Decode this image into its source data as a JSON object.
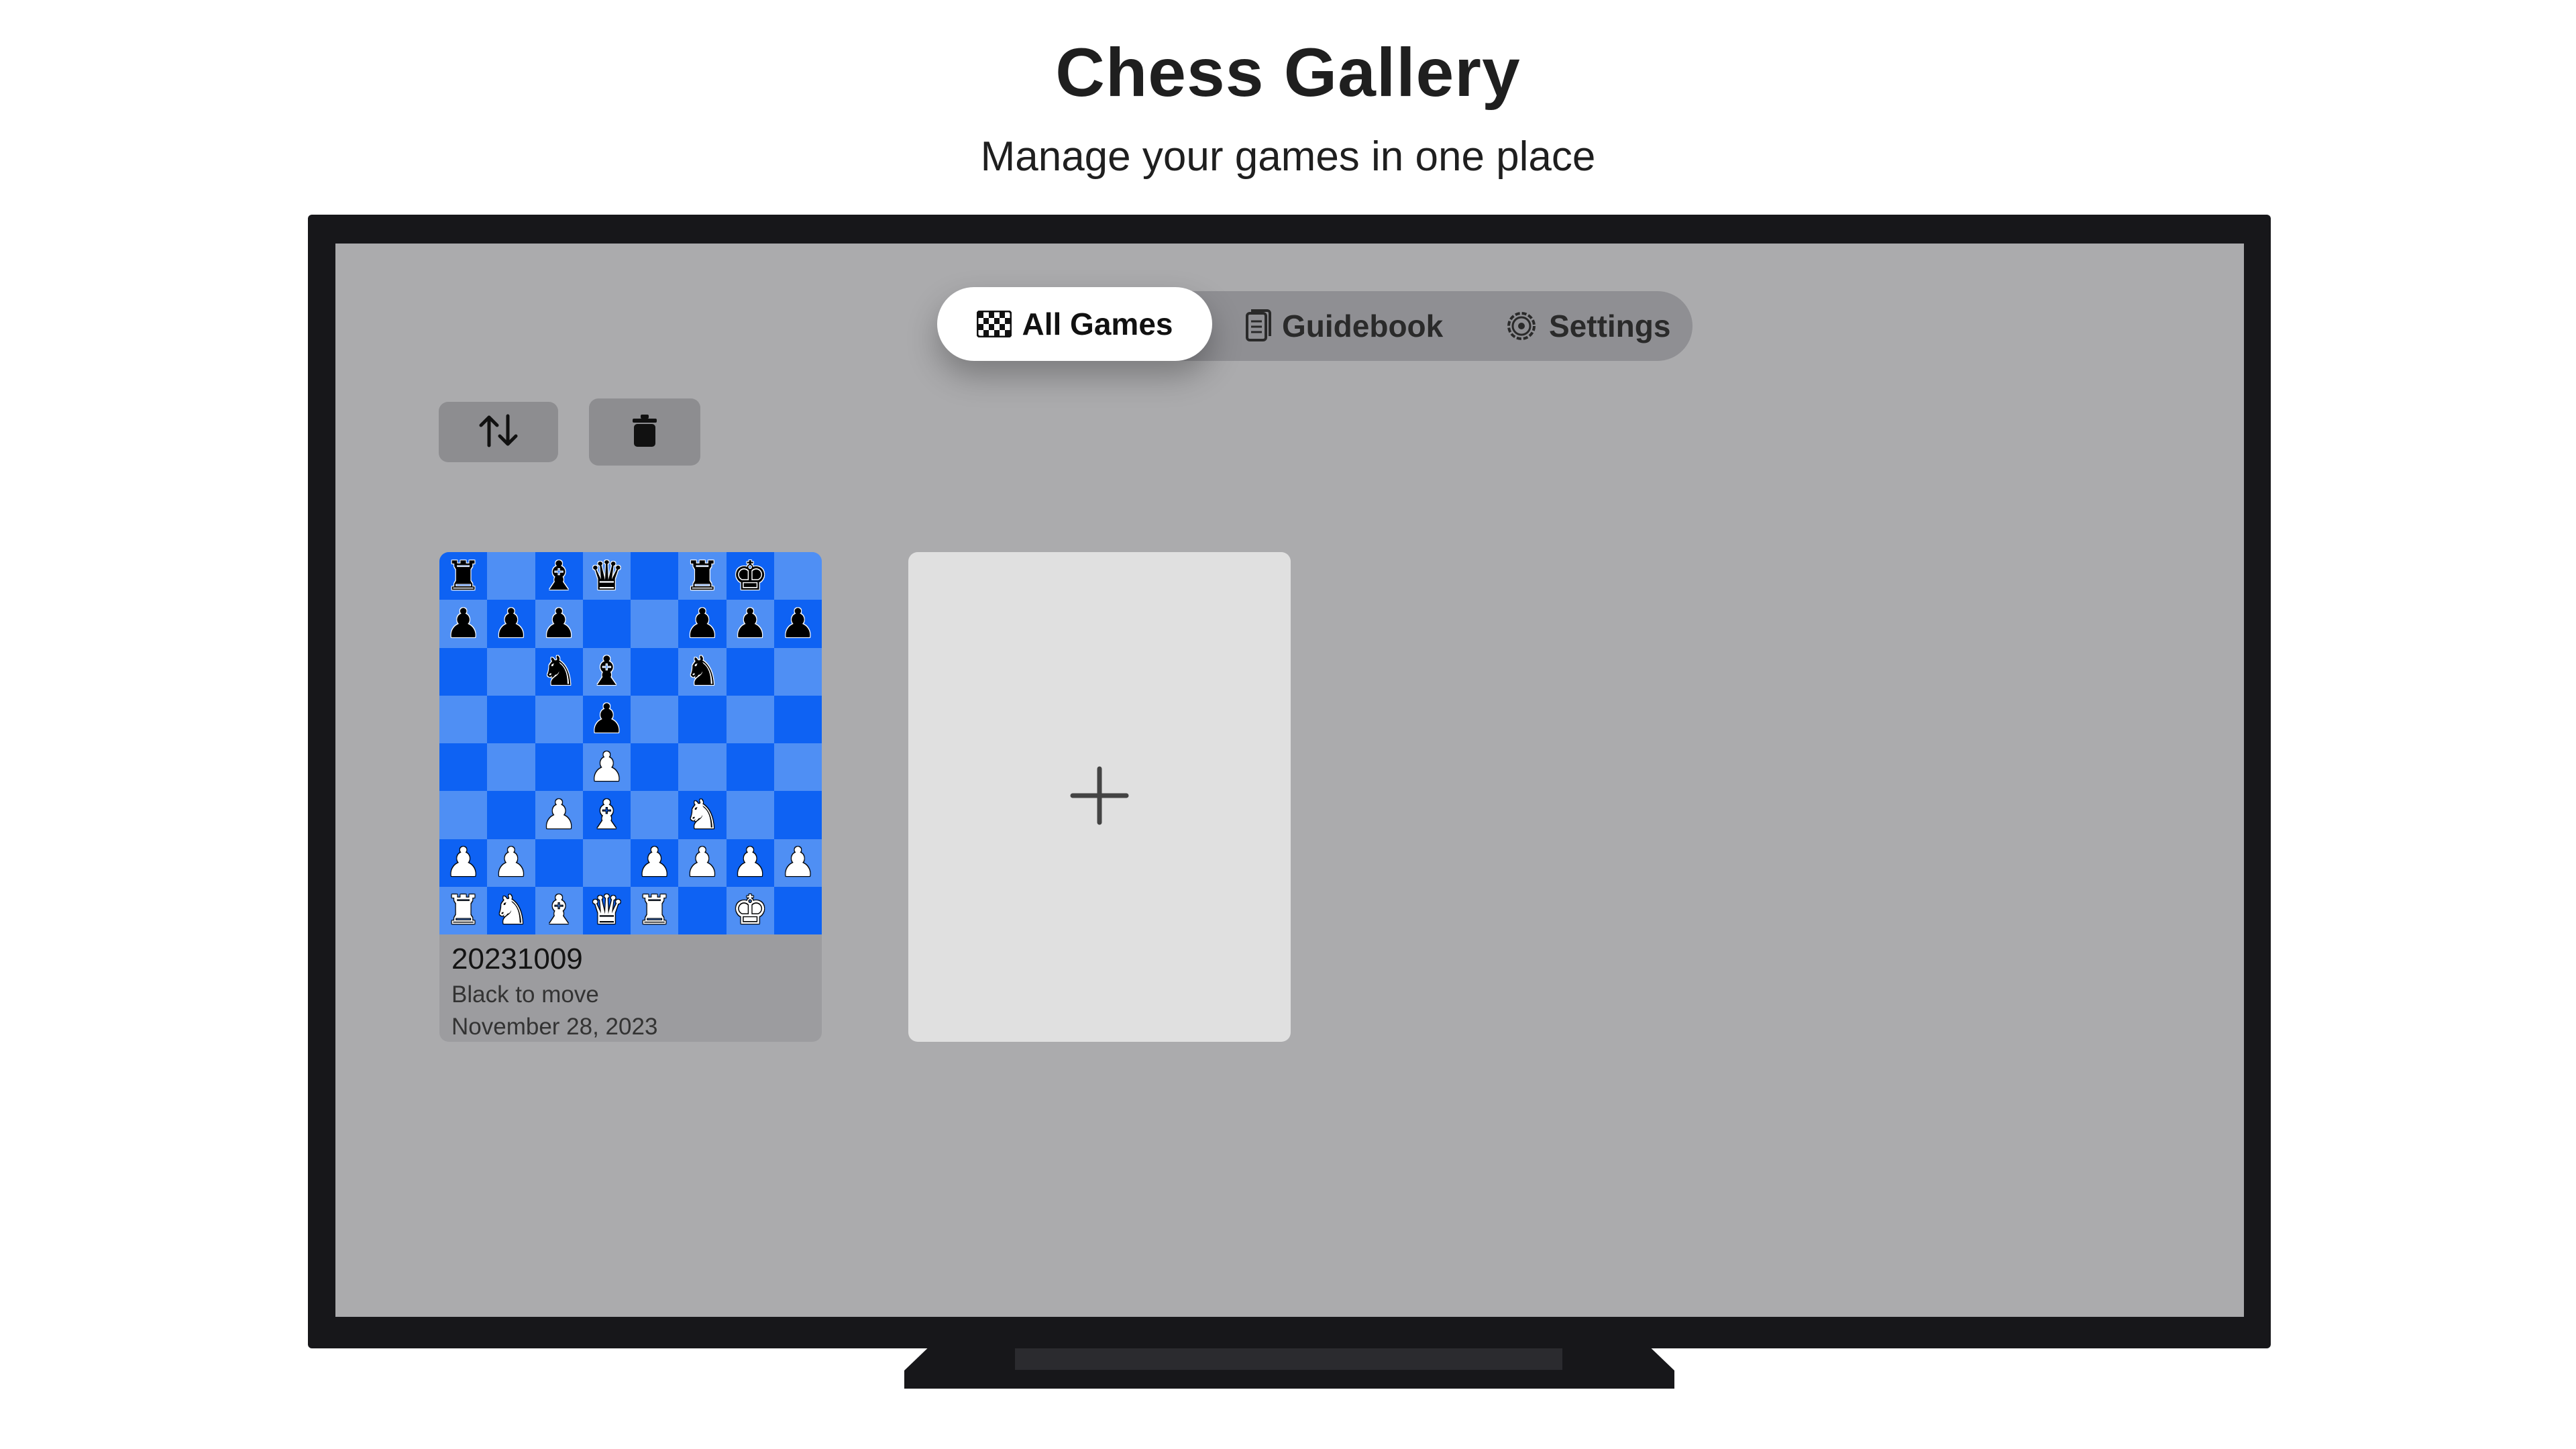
{
  "header": {
    "title": "Chess Gallery",
    "subtitle": "Manage your games in one place"
  },
  "tabs": [
    {
      "label": "All Games",
      "icon": "checkerboard-icon",
      "active": true
    },
    {
      "label": "Guidebook",
      "icon": "book-icon",
      "active": false
    },
    {
      "label": "Settings",
      "icon": "gear-icon",
      "active": false
    }
  ],
  "toolbar": {
    "sort_icon": "sort-arrows-icon",
    "delete_icon": "trash-icon"
  },
  "games": [
    {
      "name": "20231009",
      "status": "Black to move",
      "date": "November 28, 2023",
      "board": [
        [
          "r",
          "",
          "b",
          "q",
          "",
          "r",
          "k",
          ""
        ],
        [
          "p",
          "p",
          "p",
          "",
          "",
          "p",
          "p",
          "p"
        ],
        [
          "",
          "",
          "n",
          "b",
          "",
          "n",
          "",
          ""
        ],
        [
          "",
          "",
          "",
          "p",
          "",
          "",
          "",
          ""
        ],
        [
          "",
          "",
          "",
          "P",
          "",
          "",
          "",
          ""
        ],
        [
          "",
          "",
          "P",
          "B",
          "",
          "N",
          "",
          ""
        ],
        [
          "P",
          "P",
          "",
          "",
          "P",
          "P",
          "P",
          "P"
        ],
        [
          "R",
          "N",
          "B",
          "Q",
          "R",
          "",
          "K",
          ""
        ]
      ]
    }
  ],
  "new_game": {
    "icon": "plus-icon"
  },
  "colors": {
    "screen_background": "#ababad",
    "board_light": "#4f8ff4",
    "board_dark": "#0e62f3",
    "card_background": "#9c9c9f",
    "new_card_background": "#e0e0e0",
    "tab_bar": "#8f8f93"
  }
}
